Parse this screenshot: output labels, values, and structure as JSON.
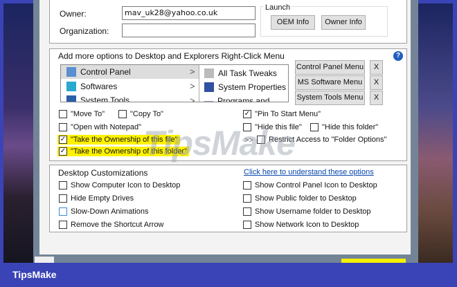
{
  "owner": {
    "label": "Owner:",
    "value": "mav_uk28@yahoo.co.uk"
  },
  "organization": {
    "label": "Organization:",
    "value": ""
  },
  "launch": {
    "title": "Launch",
    "oem": "OEM Info",
    "owner": "Owner Info"
  },
  "context": {
    "title": "Add more options to Desktop and Explorers Right-Click Menu",
    "help_icon": "question-circle-icon",
    "left_items": [
      {
        "label": "Control Panel"
      },
      {
        "label": "Softwares"
      },
      {
        "label": "System Tools"
      }
    ],
    "right_items": [
      {
        "label": "All Task Tweaks"
      },
      {
        "label": "System Properties"
      },
      {
        "label": "Programs and Featu"
      }
    ],
    "buttons": [
      "Control Panel Menu",
      "MS Software Menu",
      "System Tools Menu"
    ],
    "remove_label": "X",
    "options": [
      {
        "label": "\"Move To\"",
        "checked": false
      },
      {
        "label": "\"Copy To\"",
        "checked": false
      },
      {
        "label": "\"Open with Notepad\"",
        "checked": false
      },
      {
        "label": "\"Take the Ownership of this file\"",
        "checked": true
      },
      {
        "label": "\"Take the Ownership of this folder\"",
        "checked": true
      },
      {
        "label": "\"Pin To Start Menu\"",
        "checked": true
      },
      {
        "label": "\"Hide this file\"",
        "checked": false
      },
      {
        "label": "\"Hide this folder\"",
        "checked": false
      },
      {
        "label": "Restrict Access to \"Folder Options\"",
        "checked": false
      }
    ],
    "arrow": ">>"
  },
  "desktop": {
    "title": "Desktop Customizations",
    "link": "Click here to understand these options",
    "options": [
      {
        "label": "Show Computer Icon to Desktop",
        "checked": false
      },
      {
        "label": "Hide Empty Drives",
        "checked": false
      },
      {
        "label": "Slow-Down Animations",
        "checked": false
      },
      {
        "label": "Remove the Shortcut Arrow",
        "checked": false
      },
      {
        "label": "Show Control Panel Icon to Desktop",
        "checked": false
      },
      {
        "label": "Show Public folder to Desktop",
        "checked": false
      },
      {
        "label": "Show Username folder to Desktop",
        "checked": false
      },
      {
        "label": "Show Network Icon to Desktop",
        "checked": false
      }
    ]
  },
  "watermark": "TipsMake",
  "footer": "TipsMake",
  "colors": {
    "frame": "#3a44b6",
    "highlight": "#fff200",
    "link": "#0645ad"
  }
}
